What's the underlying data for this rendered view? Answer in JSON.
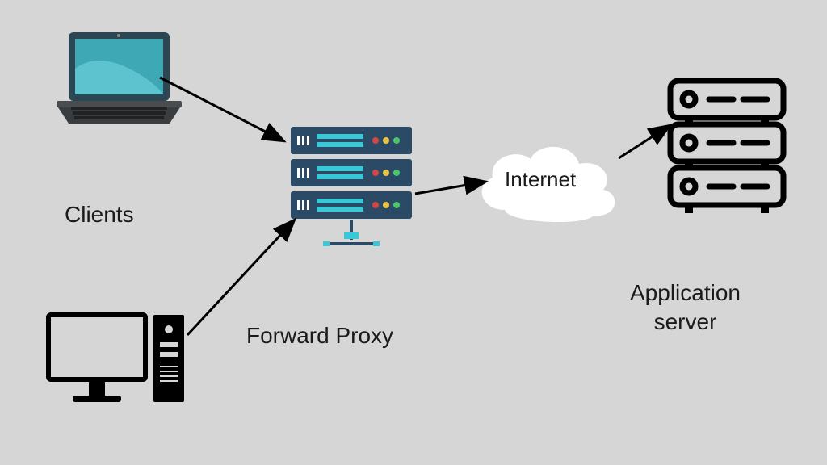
{
  "labels": {
    "clients": "Clients",
    "forward_proxy": "Forward Proxy",
    "internet": "Internet",
    "application_server": "Application\nserver"
  },
  "nodes": {
    "laptop": {
      "type": "laptop-client"
    },
    "desktop": {
      "type": "desktop-client"
    },
    "proxy": {
      "type": "forward-proxy-server"
    },
    "cloud": {
      "type": "internet-cloud"
    },
    "app_server": {
      "type": "application-server-rack"
    }
  },
  "arrows": [
    {
      "from": "laptop",
      "to": "proxy"
    },
    {
      "from": "desktop",
      "to": "proxy"
    },
    {
      "from": "proxy",
      "to": "cloud"
    },
    {
      "from": "cloud",
      "to": "app_server"
    }
  ]
}
